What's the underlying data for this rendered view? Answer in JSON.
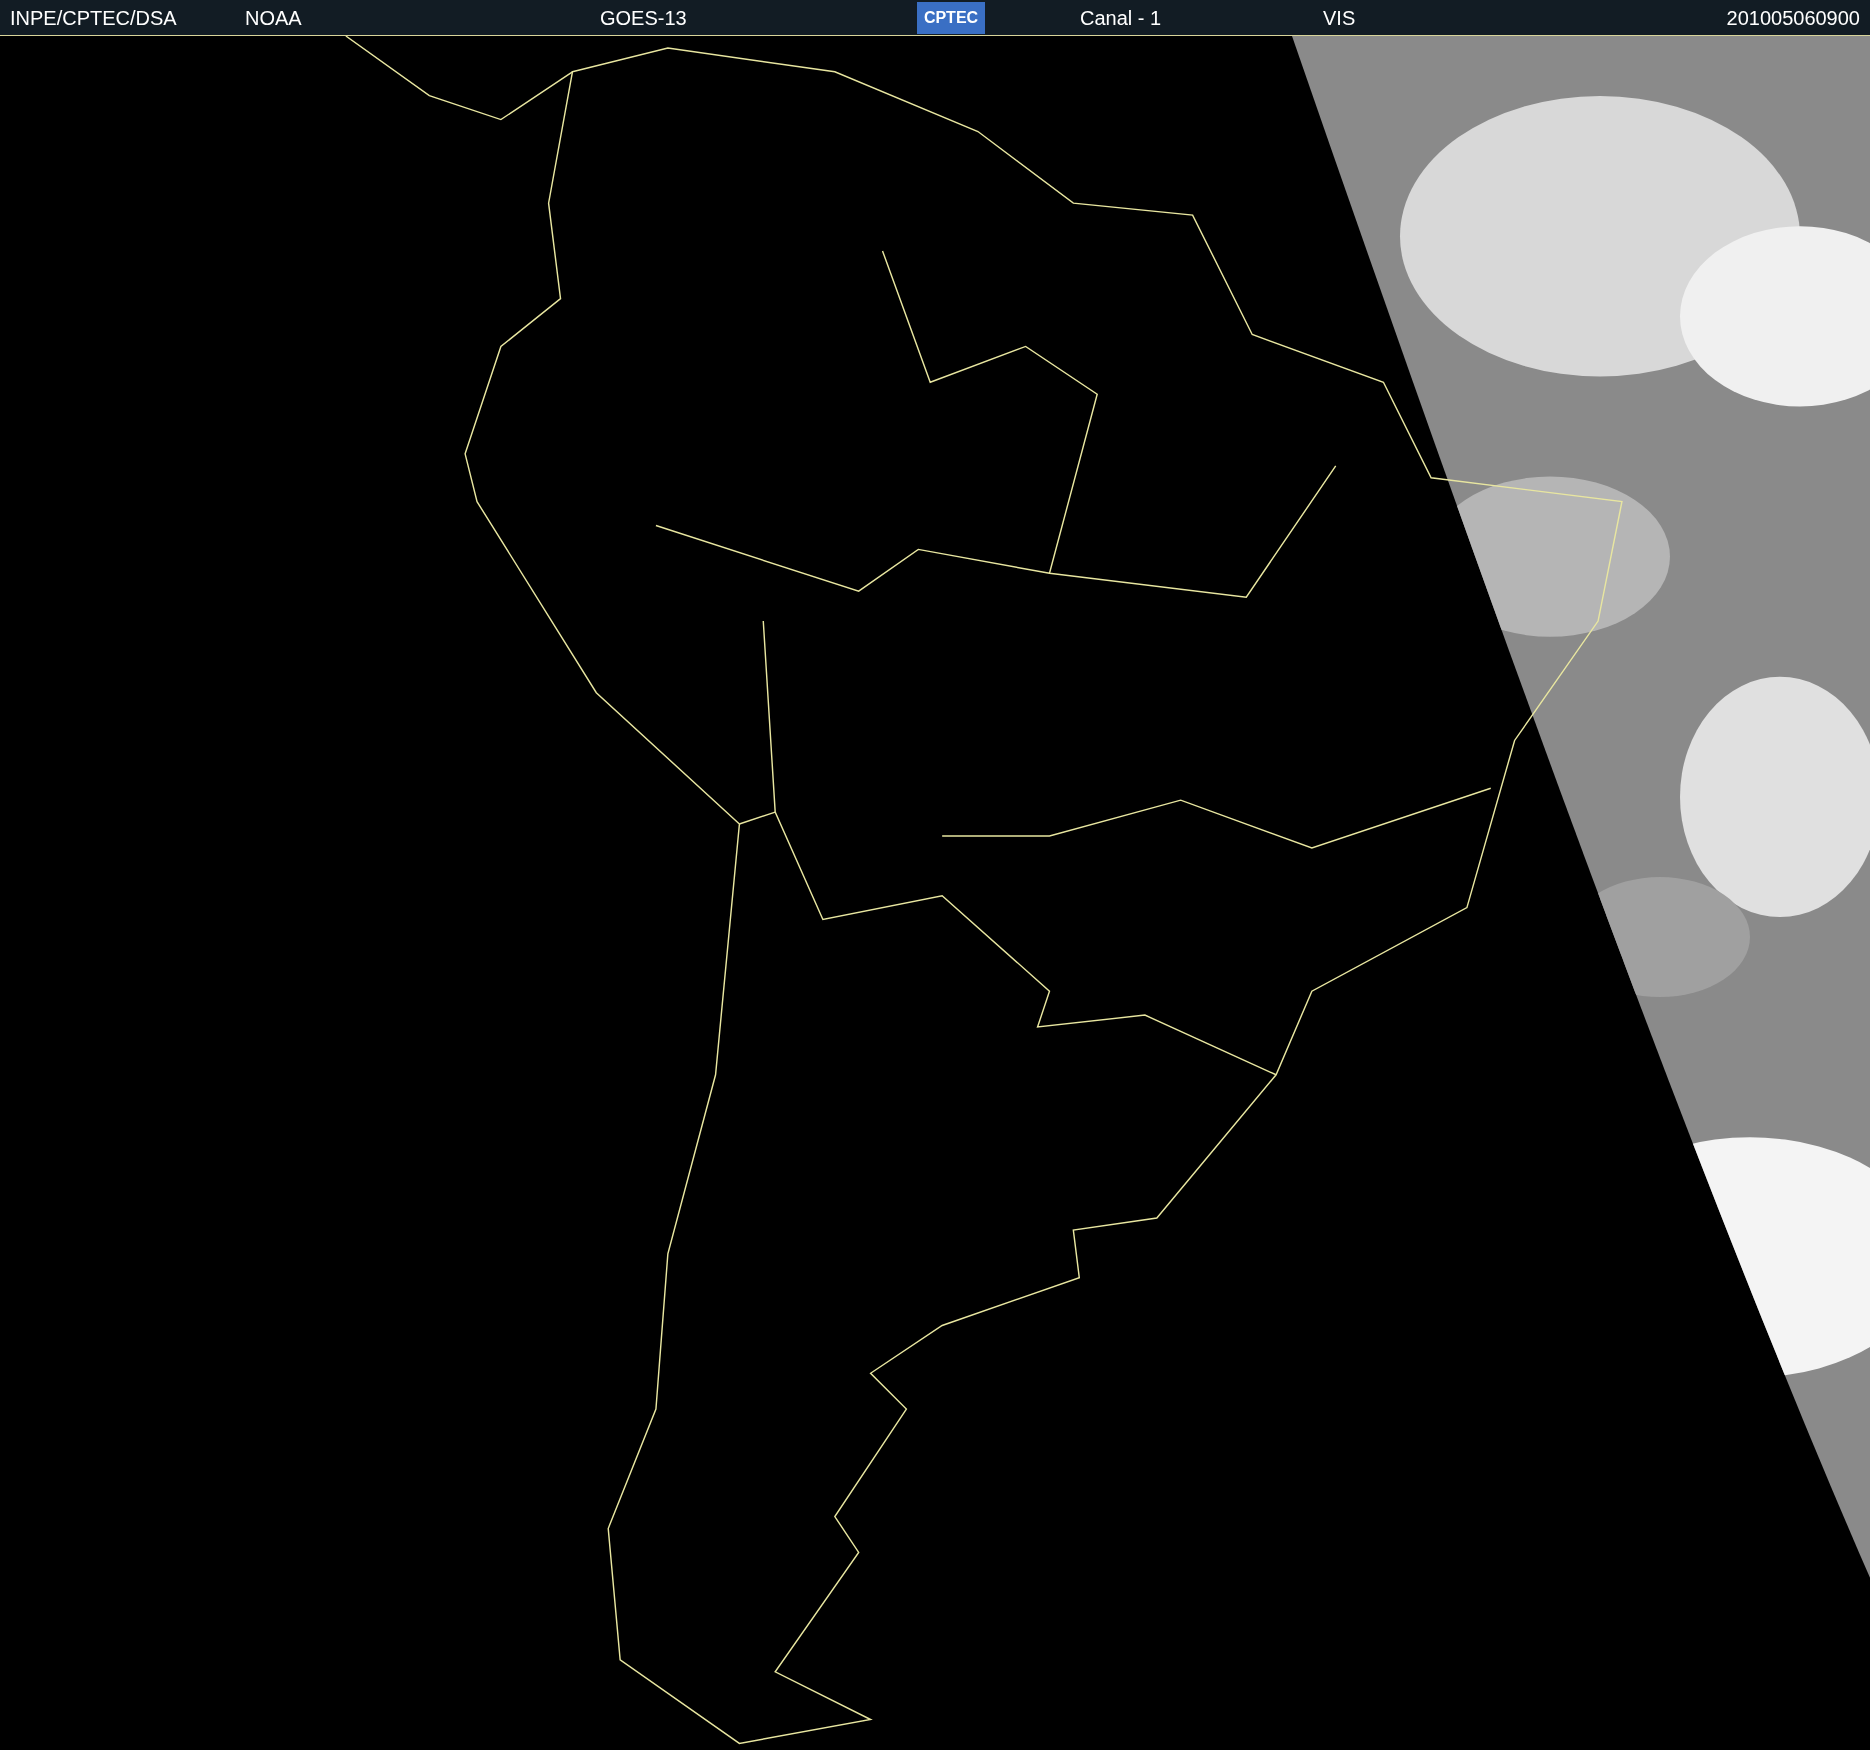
{
  "header": {
    "institution": "INPE/CPTEC/DSA",
    "agency": "NOAA",
    "satellite": "GOES-13",
    "logo": "CPTEC",
    "channel": "Canal - 1",
    "band": "VIS",
    "timestamp": "201005060900"
  }
}
